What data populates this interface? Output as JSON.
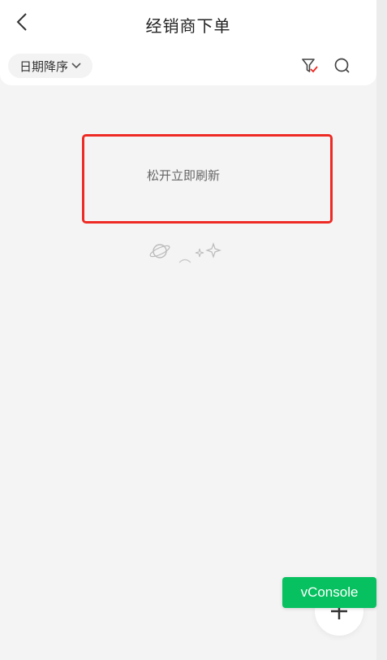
{
  "header": {
    "title": "经销商下单",
    "back_icon": "chevron-left-icon"
  },
  "toolbar": {
    "sort_label": "日期降序",
    "sort_icon": "chevron-down-icon",
    "filter_icon": "filter-icon",
    "search_icon": "search-icon"
  },
  "refresh": {
    "text": "松开立即刷新"
  },
  "empty_state": {
    "icon": "planet-sparkle-icon"
  },
  "fab": {
    "icon": "plus-icon"
  },
  "vconsole": {
    "label": "vConsole"
  },
  "colors": {
    "accent_red": "#ee2a24",
    "vconsole_green": "#07c160",
    "background": "#f4f4f4"
  }
}
